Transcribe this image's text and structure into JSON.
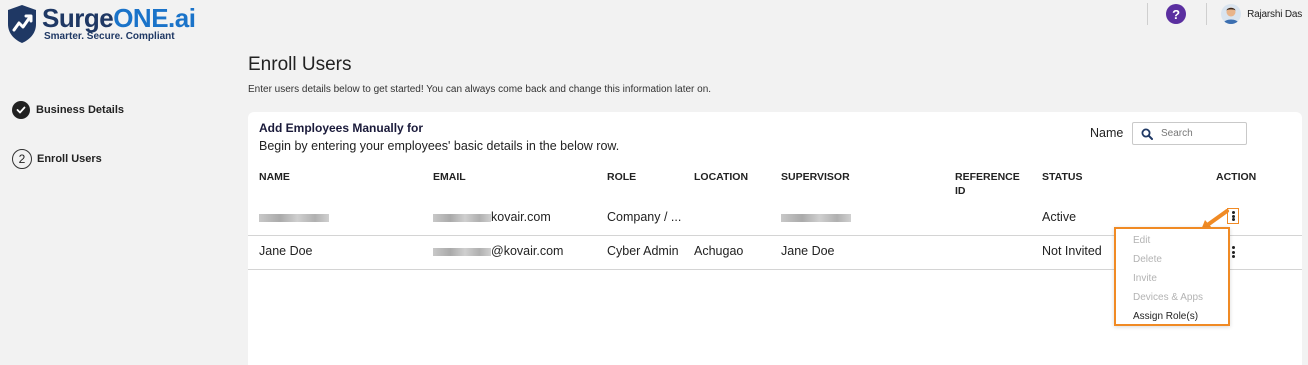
{
  "brand": {
    "name_part1": "Surge",
    "name_part2": "ONE.ai",
    "tagline": "Smarter. Secure. Compliant"
  },
  "header": {
    "help_symbol": "?",
    "user_name": "Rajarshi Das"
  },
  "steps": [
    {
      "label": "Business Details",
      "state": "done"
    },
    {
      "number": "2",
      "label": "Enroll Users",
      "state": "current"
    }
  ],
  "page": {
    "title": "Enroll Users",
    "subtitle": "Enter users details below to get started! You can always come back and change this information later on."
  },
  "card": {
    "title": "Add Employees Manually for",
    "subtitle": "Begin by entering your employees' basic details in the below row.",
    "search_label": "Name",
    "search_placeholder": "Search"
  },
  "table": {
    "columns": [
      "NAME",
      "EMAIL",
      "ROLE",
      "LOCATION",
      "SUPERVISOR",
      "REFERENCE ID",
      "STATUS",
      "ACTION"
    ],
    "rows": [
      {
        "name": "",
        "email": "kovair.com",
        "role": "Company / ...",
        "location": "",
        "supervisor": "",
        "reference_id": "",
        "status": "Active"
      },
      {
        "name": "Jane Doe",
        "email": "@kovair.com",
        "role": "Cyber Admin",
        "location": "Achugao",
        "supervisor": "Jane Doe",
        "reference_id": "",
        "status": "Not Invited"
      }
    ]
  },
  "action_menu": {
    "items": [
      {
        "label": "Edit",
        "enabled": false
      },
      {
        "label": "Delete",
        "enabled": false
      },
      {
        "label": "Invite",
        "enabled": false
      },
      {
        "label": "Devices & Apps",
        "enabled": false
      },
      {
        "label": "Assign Role(s)",
        "enabled": true
      }
    ]
  },
  "colors": {
    "brand_dark": "#1f3864",
    "brand_accent": "#1a73c9",
    "help_purple": "#5b2fa0",
    "highlight_orange": "#f08a24"
  }
}
